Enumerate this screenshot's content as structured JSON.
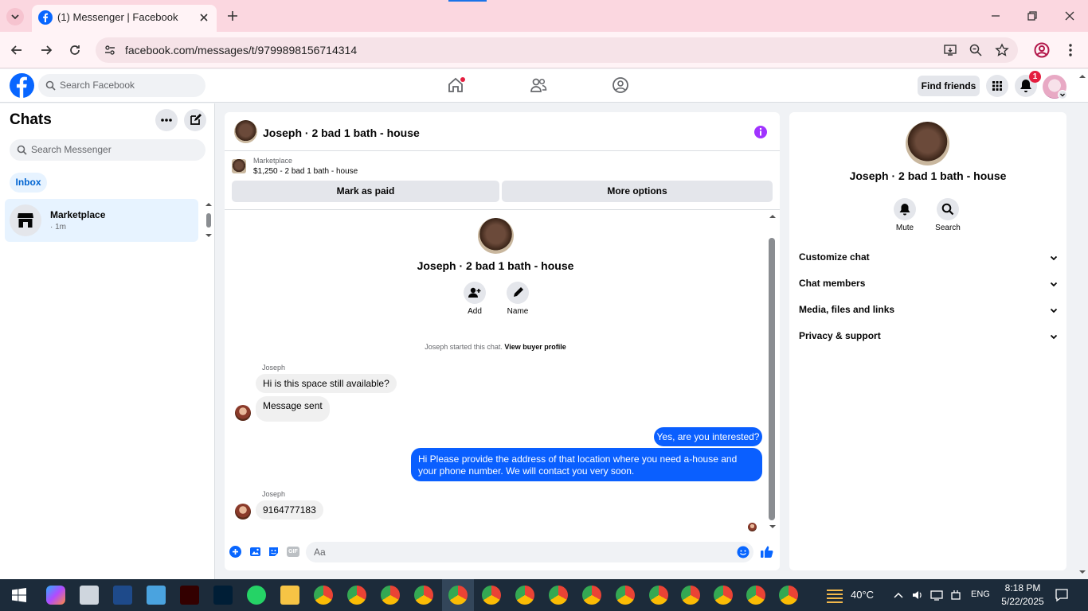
{
  "browser": {
    "tab_title": "(1) Messenger | Facebook",
    "url": "facebook.com/messages/t/9799898156714314"
  },
  "fb_header": {
    "search_placeholder": "Search Facebook",
    "find_friends": "Find friends",
    "notification_count": "1"
  },
  "sidebar": {
    "title": "Chats",
    "search_placeholder": "Search Messenger",
    "filter": "Inbox",
    "conversations": [
      {
        "name": "Marketplace",
        "time": "· 1m"
      }
    ]
  },
  "chat": {
    "title": "Joseph · 2 bad 1 bath - house",
    "marketplace_label": "Marketplace",
    "listing": "$1,250 - 2 bad 1 bath - house",
    "mark_paid": "Mark as paid",
    "more_options": "More options",
    "center_name": "Joseph · 2 bad 1 bath - house",
    "add_label": "Add",
    "name_label": "Name",
    "started_text": "Joseph started this chat.",
    "view_profile": "View buyer profile",
    "messages": [
      {
        "sender": "Joseph",
        "text": "Hi is this space still available?"
      },
      {
        "text": "Message sent"
      },
      {
        "text": "Yes, are you interested?"
      },
      {
        "text": "Hi Please provide the address of that location where you need a-house and your phone number. We will contact you very soon."
      },
      {
        "sender": "Joseph",
        "text": "9164777183"
      }
    ],
    "composer_placeholder": "Aa",
    "gif_label": "GIF"
  },
  "right_panel": {
    "name": "Joseph · 2 bad 1 bath - house",
    "mute": "Mute",
    "search": "Search",
    "sections": [
      "Customize chat",
      "Chat members",
      "Media, files and links",
      "Privacy & support"
    ]
  },
  "taskbar": {
    "temperature": "40°C",
    "language": "ENG",
    "time": "8:18 PM",
    "date": "5/22/2025"
  },
  "colors": {
    "fb_blue": "#0866ff",
    "outgoing_bubble": "#0a5fff",
    "tab_strip": "#fbd7e0",
    "accent_purple": "#a033ff"
  }
}
